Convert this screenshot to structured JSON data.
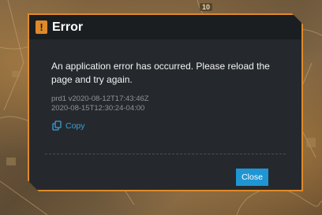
{
  "background": {
    "map_badge": "10"
  },
  "dialog": {
    "title": "Error",
    "title_icon": "warning-icon",
    "message": "An application error has occurred. Please reload the page and try again.",
    "meta_lines": [
      "prd1 v2020-08-12T17:43:46Z",
      "2020-08-15T12:30:24-04:00"
    ],
    "copy_label": "Copy",
    "copy_icon": "copy-icon",
    "close_label": "Close"
  },
  "colors": {
    "accent_orange": "#e0892a",
    "dialog_bg": "#25292d",
    "header_bg": "#1b1e21",
    "link_blue": "#3aa0d8",
    "button_blue": "#1f96d3"
  }
}
